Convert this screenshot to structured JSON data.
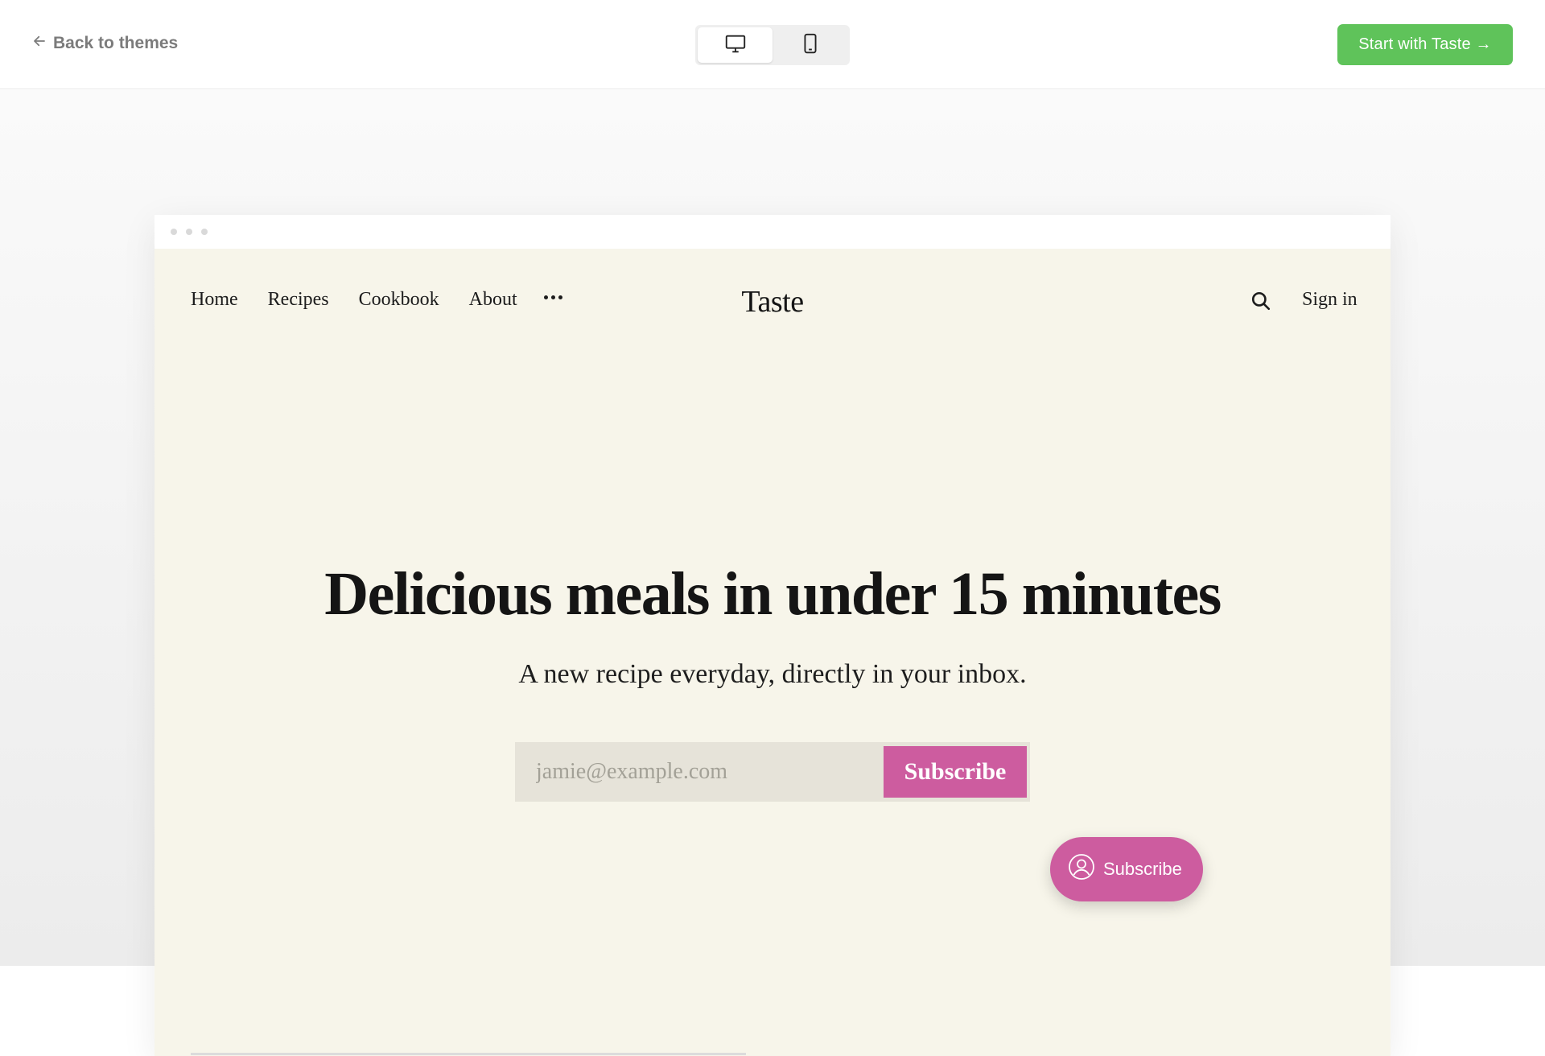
{
  "toolbar": {
    "back_label": "Back to themes",
    "start_label": "Start with Taste →",
    "accent_color": "#5fc35a",
    "devices": [
      {
        "icon": "desktop-icon",
        "active": true
      },
      {
        "icon": "mobile-icon",
        "active": false
      }
    ]
  },
  "site": {
    "title": "Taste",
    "nav": [
      "Home",
      "Recipes",
      "Cookbook",
      "About"
    ],
    "more_icon": "more-dots-icon",
    "sign_in": "Sign in",
    "background": "#f7f5ea",
    "brand_color": "#cd5c9f"
  },
  "hero": {
    "title": "Delicious meals in under 15 minutes",
    "subtitle": "A new recipe everyday, directly in your inbox.",
    "email_placeholder": "jamie@example.com",
    "subscribe_label": "Subscribe"
  },
  "portal": {
    "label": "Subscribe",
    "icon": "user-circle-icon"
  }
}
